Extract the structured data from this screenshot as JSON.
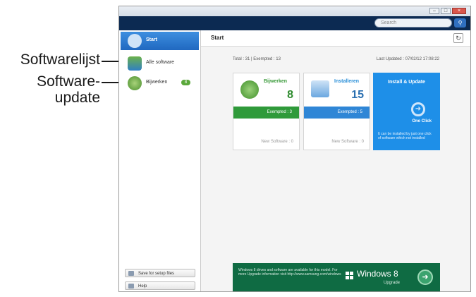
{
  "callouts": {
    "softwarelist": "Softwarelijst",
    "softwareupdate_line1": "Software-",
    "softwareupdate_line2": "update"
  },
  "window": {
    "search_placeholder": "Search",
    "search_icon": "search-icon",
    "title_buttons": [
      "–",
      "□",
      "×"
    ]
  },
  "sidebar": {
    "items": [
      {
        "label": "Start",
        "icon": "home-icon"
      },
      {
        "label": "Alle software",
        "icon": "software-list-icon"
      },
      {
        "label": "Bijwerken",
        "icon": "update-icon",
        "badge": "8"
      }
    ],
    "bottom_buttons": [
      {
        "label": "Save for setup files",
        "icon": "save-icon"
      },
      {
        "label": "Help",
        "icon": "help-icon"
      }
    ]
  },
  "main": {
    "title": "Start",
    "refresh_icon": "refresh-icon",
    "total_text": "Total : 31 | Exempted : 13",
    "last_updated": "Last Updated : 07/02/12 17:08:22",
    "tiles": [
      {
        "name": "Bijwerken",
        "number": "8",
        "bar": "Exempted : 3",
        "new": "New Software : 0",
        "icon": "update-icon"
      },
      {
        "name": "Installeren",
        "number": "15",
        "bar": "Exempted : 5",
        "new": "New Software : 0",
        "icon": "install-icon"
      }
    ],
    "install_tile": {
      "title": "Install & Update",
      "action": "One Click",
      "desc": "It can be installed by just one click of software which not installed",
      "icon": "arrow-right-icon"
    },
    "banner": {
      "text": "Windows 8 drives and software are available for this model. For more Upgrade information visit http://www.samsung.com/windows",
      "name": "Windows 8",
      "sub": "Upgrade",
      "icon": "arrow-right-icon"
    }
  },
  "colors": {
    "topbar": "#0c2a52",
    "accent_blue": "#2f86d6",
    "accent_green": "#2f9a3a",
    "banner_green": "#0f6b43"
  }
}
